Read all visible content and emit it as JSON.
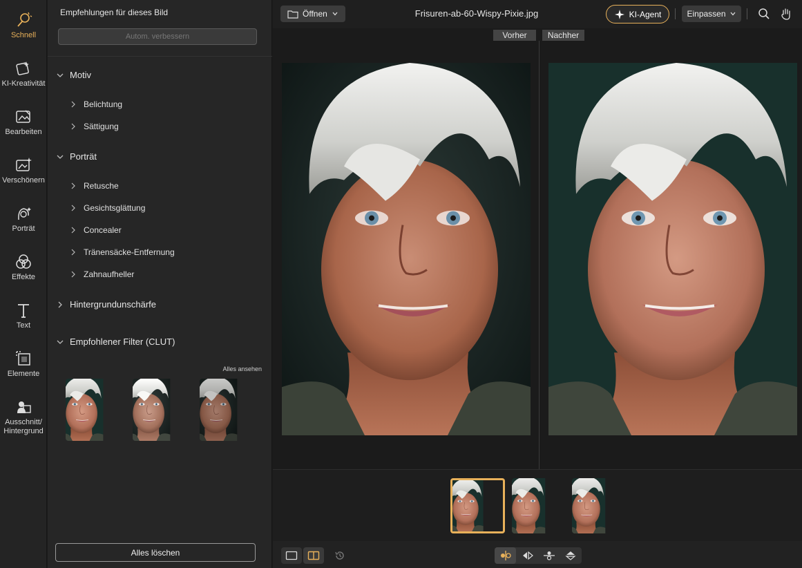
{
  "rail": {
    "items": [
      {
        "label": "Schnell",
        "icon": "magic-wand-icon",
        "active": true
      },
      {
        "label": "KI-Kreativität",
        "icon": "ai-creative-icon"
      },
      {
        "label": "Bearbeiten",
        "icon": "edit-image-icon"
      },
      {
        "label": "Verschönern",
        "icon": "beautify-icon"
      },
      {
        "label": "Porträt",
        "icon": "portrait-icon"
      },
      {
        "label": "Effekte",
        "icon": "effects-icon"
      },
      {
        "label": "Text",
        "icon": "text-icon"
      },
      {
        "label": "Elemente",
        "icon": "elements-icon"
      },
      {
        "label": "Ausschnitt/ Hintergrund",
        "icon": "cutout-icon"
      }
    ]
  },
  "panel": {
    "title": "Empfehlungen für dieses Bild",
    "auto_enhance": "Autom. verbessern",
    "sections": {
      "motiv": {
        "label": "Motiv",
        "items": [
          "Belichtung",
          "Sättigung"
        ]
      },
      "portrait": {
        "label": "Porträt",
        "items": [
          "Retusche",
          "Gesichtsglättung",
          "Concealer",
          "Tränensäcke-Entfernung",
          "Zahnaufheller"
        ]
      },
      "background_blur": {
        "label": "Hintergrundunschärfe"
      },
      "clut": {
        "label": "Empfohlener Filter (CLUT)"
      }
    },
    "see_all": "Alles ansehen",
    "clear_all": "Alles löschen"
  },
  "topbar": {
    "open_label": "Öffnen",
    "filename": "Frisuren-ab-60-Wispy-Pixie.jpg",
    "agent_label": "KI-Agent",
    "fit_label": "Einpassen"
  },
  "canvas": {
    "before_label": "Vorher",
    "after_label": "Nachher"
  },
  "colors": {
    "accent": "#e8b15a",
    "background": "#1b1b1b",
    "panel": "#262626"
  }
}
